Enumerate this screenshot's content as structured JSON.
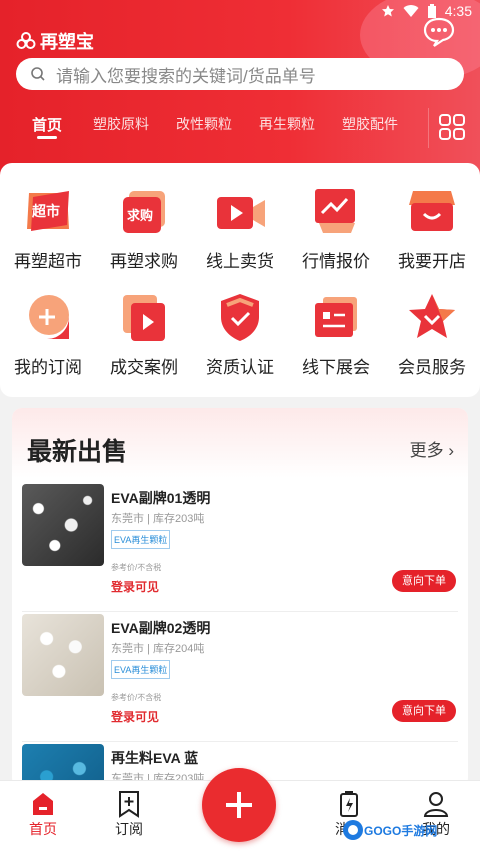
{
  "status": {
    "time": "4:35"
  },
  "app": {
    "name": "再塑宝"
  },
  "search": {
    "placeholder": "请输入您要搜索的关键词/货品单号"
  },
  "tabs": [
    "首页",
    "塑胶原料",
    "改性颗粒",
    "再生颗粒",
    "塑胶配件"
  ],
  "categories": [
    {
      "label": "再塑超市",
      "icon": "supermarket-icon",
      "badge": "超市"
    },
    {
      "label": "再塑求购",
      "icon": "purchase-request-icon",
      "badge": "求购"
    },
    {
      "label": "线上卖货",
      "icon": "video-sell-icon"
    },
    {
      "label": "行情报价",
      "icon": "trend-chart-icon"
    },
    {
      "label": "我要开店",
      "icon": "shop-icon"
    },
    {
      "label": "我的订阅",
      "icon": "subscribe-plus-icon"
    },
    {
      "label": "成交案例",
      "icon": "play-case-icon"
    },
    {
      "label": "资质认证",
      "icon": "shield-check-icon"
    },
    {
      "label": "线下展会",
      "icon": "exhibition-icon"
    },
    {
      "label": "会员服务",
      "icon": "member-star-icon"
    }
  ],
  "sale": {
    "title": "最新出售",
    "more": "更多",
    "items": [
      {
        "title": "EVA副牌01透明",
        "meta": "东莞市 | 库存203吨",
        "tag": "EVA再生颗粒",
        "ref": "参考价/不含税",
        "price": "登录可见",
        "action": "意向下单"
      },
      {
        "title": "EVA副牌02透明",
        "meta": "东莞市 | 库存204吨",
        "tag": "EVA再生颗粒",
        "ref": "参考价/不含税",
        "price": "登录可见",
        "action": "意向下单"
      },
      {
        "title": "再生料EVA 蓝",
        "meta": "东莞市 | 库存203吨",
        "tag": "",
        "ref": "",
        "price": "",
        "action": ""
      }
    ]
  },
  "bottom_nav": [
    {
      "label": "首页",
      "icon": "home-icon"
    },
    {
      "label": "订阅",
      "icon": "bookmark-plus-icon"
    },
    {
      "label": "消息",
      "icon": "message-battery-icon"
    },
    {
      "label": "我的",
      "icon": "profile-icon"
    }
  ],
  "watermark": "GOGO手游网",
  "colors": {
    "brand": "#e5222a",
    "link": "#2a8ed8"
  }
}
